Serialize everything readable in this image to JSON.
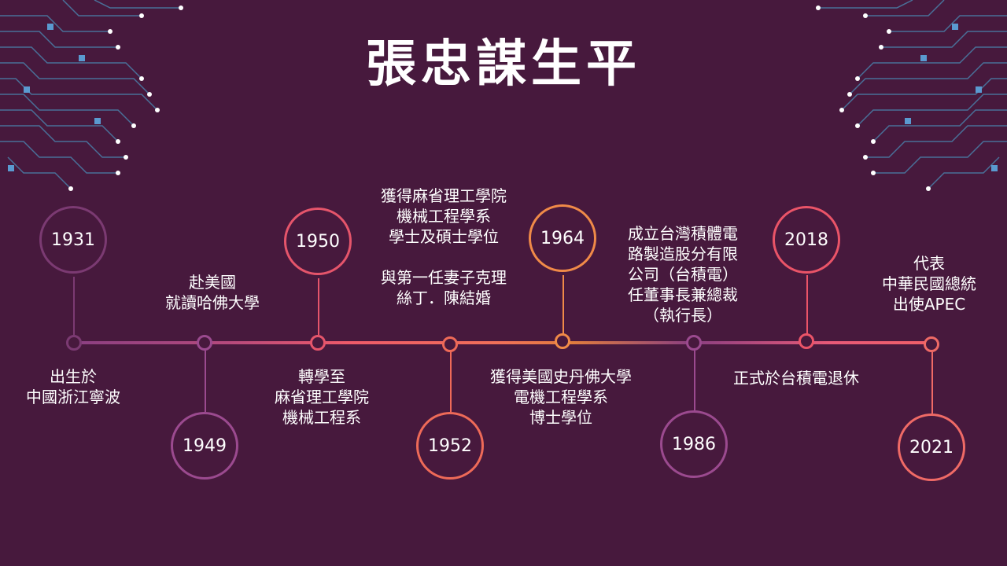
{
  "title": "張忠謀生平",
  "events": [
    {
      "year": "1931",
      "text": "出生於\n中國浙江寧波",
      "color": "#7b3a72"
    },
    {
      "year": "1949",
      "text": "赴美國\n就讀哈佛大學",
      "color": "#9b4a8f"
    },
    {
      "year": "1950",
      "text": "轉學至\n麻省理工學院\n機械工程系",
      "color": "#e5556b"
    },
    {
      "year": "1952",
      "text": "獲得麻省理工學院\n機械工程學系\n學士及碩士學位\n\n與第一任妻子克理\n絲丁．陳結婚",
      "color": "#ee6a58"
    },
    {
      "year": "1964",
      "text": "獲得美國史丹佛大學\n電機工程學系\n博士學位",
      "color": "#f08a48"
    },
    {
      "year": "1986",
      "text": "成立台灣積體電\n路製造股分有限\n公司（台積電）\n任董事長兼總裁\n（執行長）",
      "color": "#9b4a8f"
    },
    {
      "year": "2018",
      "text": "正式於台積電退休",
      "color": "#ea5468"
    },
    {
      "year": "2021",
      "text": "代表\n中華民國總統\n出使APEC",
      "color": "#ef6a66"
    }
  ]
}
